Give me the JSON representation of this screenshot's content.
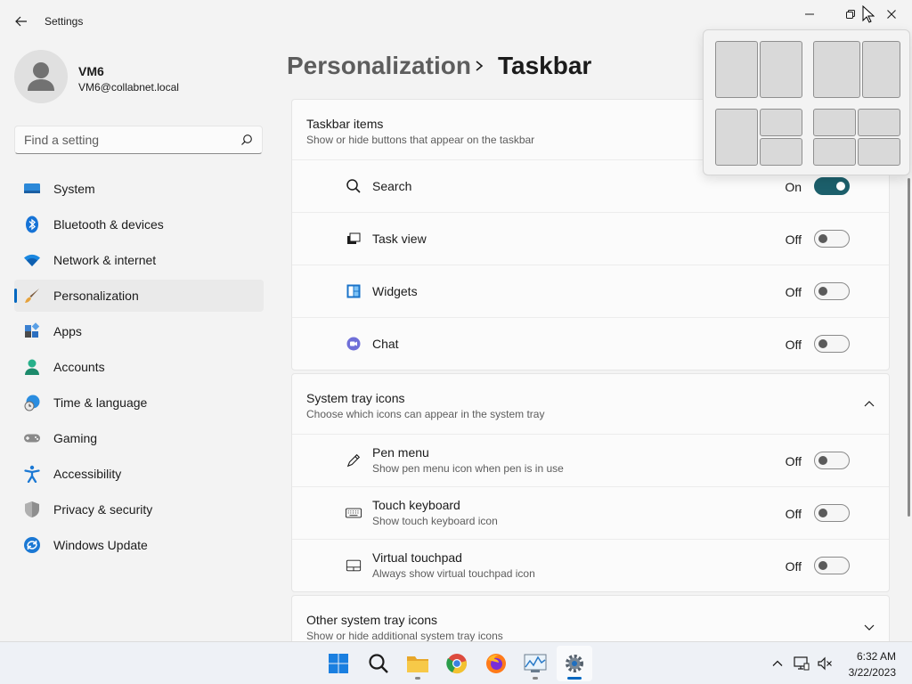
{
  "window": {
    "title": "Settings",
    "controls": {
      "minimize": "minimize",
      "maximize": "maximize",
      "close": "close"
    }
  },
  "account": {
    "name": "VM6",
    "email": "VM6@collabnet.local"
  },
  "search": {
    "placeholder": "Find a setting",
    "value": ""
  },
  "sidebar": {
    "items": [
      {
        "label": "System",
        "icon": "monitor-icon"
      },
      {
        "label": "Bluetooth & devices",
        "icon": "bluetooth-icon"
      },
      {
        "label": "Network & internet",
        "icon": "wifi-icon"
      },
      {
        "label": "Personalization",
        "icon": "brush-icon",
        "active": true
      },
      {
        "label": "Apps",
        "icon": "apps-icon"
      },
      {
        "label": "Accounts",
        "icon": "person-icon"
      },
      {
        "label": "Time & language",
        "icon": "globe-clock-icon"
      },
      {
        "label": "Gaming",
        "icon": "gamepad-icon"
      },
      {
        "label": "Accessibility",
        "icon": "accessibility-icon"
      },
      {
        "label": "Privacy & security",
        "icon": "shield-icon"
      },
      {
        "label": "Windows Update",
        "icon": "update-icon"
      }
    ]
  },
  "header": {
    "parent": "Personalization",
    "current": "Taskbar"
  },
  "taskbar_items": {
    "title": "Taskbar items",
    "subtitle": "Show or hide buttons that appear on the taskbar",
    "rows": [
      {
        "label": "Search",
        "state": "On",
        "on": true,
        "icon": "search-icon"
      },
      {
        "label": "Task view",
        "state": "Off",
        "on": false,
        "icon": "task-view-icon"
      },
      {
        "label": "Widgets",
        "state": "Off",
        "on": false,
        "icon": "widgets-icon"
      },
      {
        "label": "Chat",
        "state": "Off",
        "on": false,
        "icon": "chat-icon"
      }
    ]
  },
  "system_tray": {
    "title": "System tray icons",
    "subtitle": "Choose which icons can appear in the system tray",
    "rows": [
      {
        "label": "Pen menu",
        "desc": "Show pen menu icon when pen is in use",
        "state": "Off",
        "on": false,
        "icon": "pen-icon"
      },
      {
        "label": "Touch keyboard",
        "desc": "Show touch keyboard icon",
        "state": "Off",
        "on": false,
        "icon": "keyboard-icon"
      },
      {
        "label": "Virtual touchpad",
        "desc": "Always show virtual touchpad icon",
        "state": "Off",
        "on": false,
        "icon": "touchpad-icon"
      }
    ]
  },
  "other_tray": {
    "title": "Other system tray icons",
    "subtitle": "Show or hide additional system tray icons"
  },
  "clock": {
    "time": "6:32 AM",
    "date": "3/22/2023"
  },
  "colors": {
    "accent": "#0067c0",
    "toggle_on": "#1c5f6b"
  }
}
